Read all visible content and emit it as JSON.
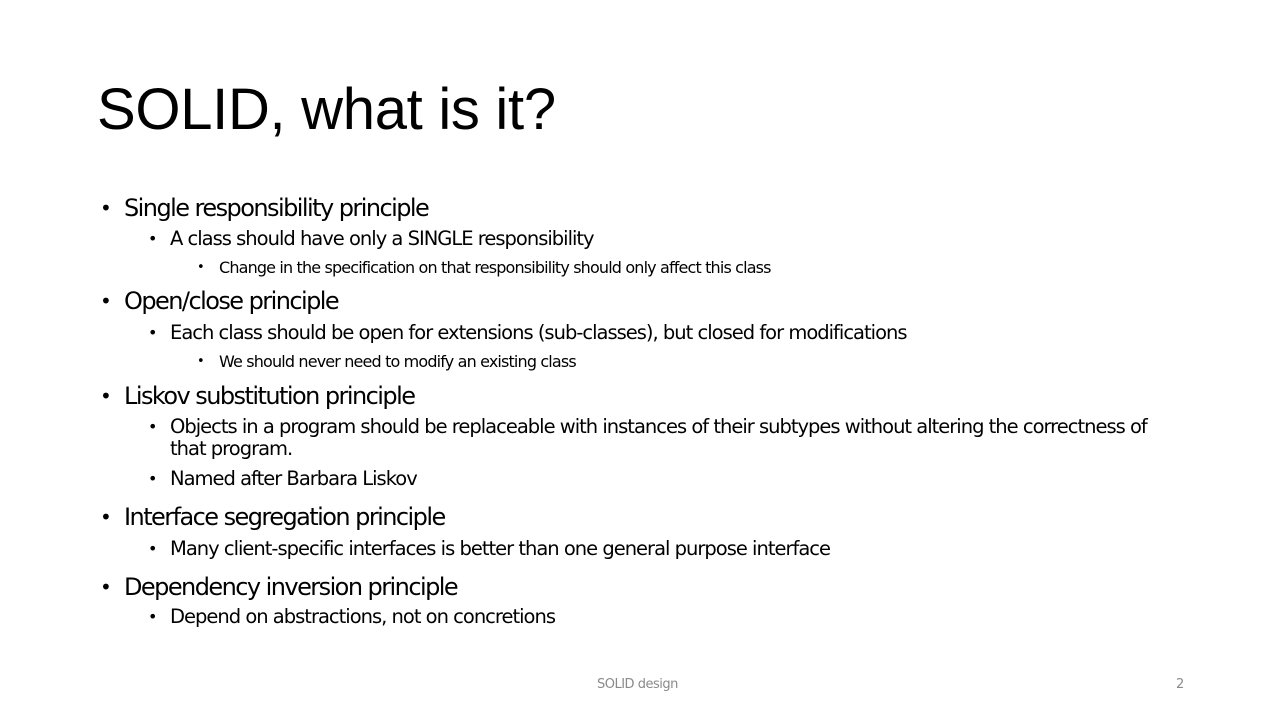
{
  "slide": {
    "title": "SOLID, what is it?",
    "bullet_glyph": "•",
    "items": [
      {
        "text": "Single responsibility principle"
      },
      {
        "text": "A class should have only a SINGLE responsibility"
      },
      {
        "text": "Change in the specification on that responsibility should only affect this class"
      },
      {
        "text": "Open/close principle"
      },
      {
        "text": "Each class should be open for extensions (sub-classes), but closed for modifications"
      },
      {
        "text": "We should never need to modify an existing class"
      },
      {
        "text": "Liskov substitution principle"
      },
      {
        "text": "Objects in a program should be replaceable with instances of their subtypes without altering the correctness of that program."
      },
      {
        "text": "Named after Barbara Liskov"
      },
      {
        "text": "Interface segregation principle"
      },
      {
        "text": "Many client-specific interfaces is better than one general purpose interface"
      },
      {
        "text": "Dependency inversion principle"
      },
      {
        "text": "Depend on abstractions, not on concretions"
      }
    ],
    "footer": {
      "text": "SOLID design",
      "page_number": "2"
    }
  }
}
